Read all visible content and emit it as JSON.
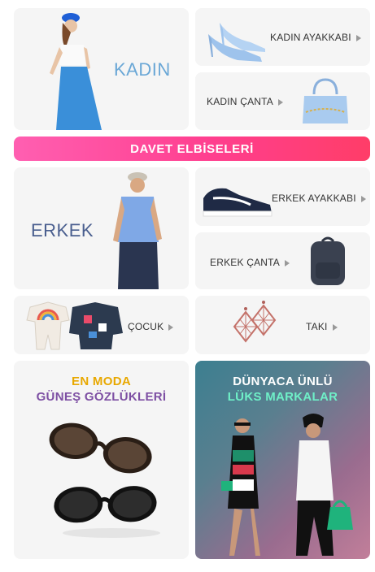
{
  "tiles": {
    "kadin": {
      "label": "KADIN"
    },
    "kadin_ayakkabi": {
      "label": "KADIN AYAKKABI"
    },
    "kadin_canta": {
      "label": "KADIN ÇANTA"
    },
    "erkek": {
      "label": "ERKEK"
    },
    "erkek_ayakkabi": {
      "label": "ERKEK AYAKKABI"
    },
    "erkek_canta": {
      "label": "ERKEK ÇANTA"
    },
    "cocuk": {
      "label": "ÇOCUK"
    },
    "taki": {
      "label": "TAKI"
    }
  },
  "banner": {
    "label": "DAVET ELBİSELERİ"
  },
  "promos": {
    "sunglasses": {
      "line1": "EN MODA",
      "line2": "GÜNEŞ GÖZLÜKLERİ"
    },
    "luxury": {
      "line1": "DÜNYACA ÜNLÜ",
      "line2": "LÜKS MARKALAR"
    }
  },
  "colors": {
    "kadin_label": "#6aa7d6",
    "erkek_label": "#4a5f8f",
    "sunglasses_line1": "#e8a800",
    "sunglasses_line2": "#7d4fa3",
    "luxury_line2": "#6ff0c8"
  }
}
